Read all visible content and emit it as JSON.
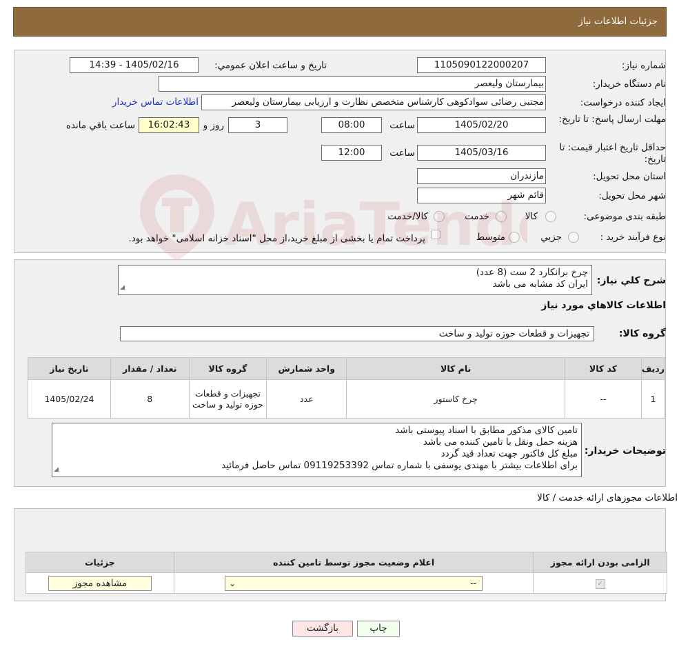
{
  "header": {
    "title": "جزئیات اطلاعات نیاز"
  },
  "details": {
    "need_number_label": "شماره نیاز:",
    "need_number": "1105090122000207",
    "announce_label": "تاریخ و ساعت اعلان عمومي:",
    "announce_value": "1405/02/16 - 14:39",
    "buyer_org_label": "نام دستگاه خریدار:",
    "buyer_org": "بیمارستان ولیعصر",
    "requester_label": "ایجاد کننده درخواست:",
    "requester": "مجتبی رضائی سوادکوهی کارشناس متخصص نظارت و ارزیابی بیمارستان ولیعصر",
    "contact_link": "اطلاعات تماس خریدار",
    "reply_deadline_label": "مهلت ارسال پاسخ: تا تاریخ:",
    "reply_date": "1405/02/20",
    "time_label": "ساعت",
    "reply_time": "08:00",
    "days_value": "3",
    "days_label": "روز و",
    "remaining_time": "16:02:43",
    "remaining_label": "ساعت باقي مانده",
    "price_validity_label": "حداقل تاریخ اعتبار قیمت: تا تاریخ:",
    "price_date": "1405/03/16",
    "price_time": "12:00",
    "province_label": "استان محل تحویل:",
    "province": "مازندران",
    "city_label": "شهر محل تحویل:",
    "city": "قائم شهر",
    "category_label": "طبقه بندی موضوعی:",
    "category_options": [
      "کالا",
      "خدمت",
      "کالا/خدمت"
    ],
    "process_label": "نوع فرآیند خرید :",
    "process_options": [
      "جزيي",
      "متوسط"
    ],
    "payment_note": "پرداخت تمام یا بخشی از مبلغ خرید،از محل \"اسناد خزانه اسلامی\" خواهد بود."
  },
  "summary": {
    "label": "شرح کلي نياز:",
    "lines": [
      "چرخ برانکارد 2 ست (8 عدد)",
      "ایران کد مشابه می باشد"
    ],
    "goods_info_title": "اطلاعات کالاهاي مورد نياز",
    "goods_group_label": "گروه کالا:",
    "goods_group": "تجهیزات و قطعات حوزه تولید و ساخت"
  },
  "items_table": {
    "headers": [
      "رديف",
      "کد کالا",
      "نام کالا",
      "واحد شمارش",
      "گروه کالا",
      "تعداد / مقدار",
      "تاریخ نیاز"
    ],
    "rows": [
      [
        "1",
        "--",
        "چرخ کاستور",
        "عدد",
        "تجهیزات و قطعات حوزه تولید و ساخت",
        "8",
        "1405/02/24"
      ]
    ]
  },
  "buyer_notes": {
    "label": "توضیحات خریدار:",
    "lines": [
      "تامین کالای مذکور مطابق با اسناد پیوستی باشد",
      "هزینه حمل ونقل با تامین کننده می باشد",
      "مبلغ کل  فاکتور جهت تعداد قید گردد",
      "برای اطلاعات بیشتر با مهندی یوسفی با شماره تماس 09119253392 تماس حاصل فرمائید"
    ]
  },
  "licenses": {
    "title": "اطلاعات مجوزهای ارائه خدمت / کالا",
    "headers": [
      "الزامی بودن ارائه مجوز",
      "اعلام وضعیت مجوز توسط تامین کننده",
      "جزئیات"
    ],
    "select_value": "--",
    "view_button": "مشاهده مجوز"
  },
  "actions": {
    "print": "چاپ",
    "back": "بازگشت"
  },
  "watermark": {
    "text": "AriaTender.neT"
  }
}
